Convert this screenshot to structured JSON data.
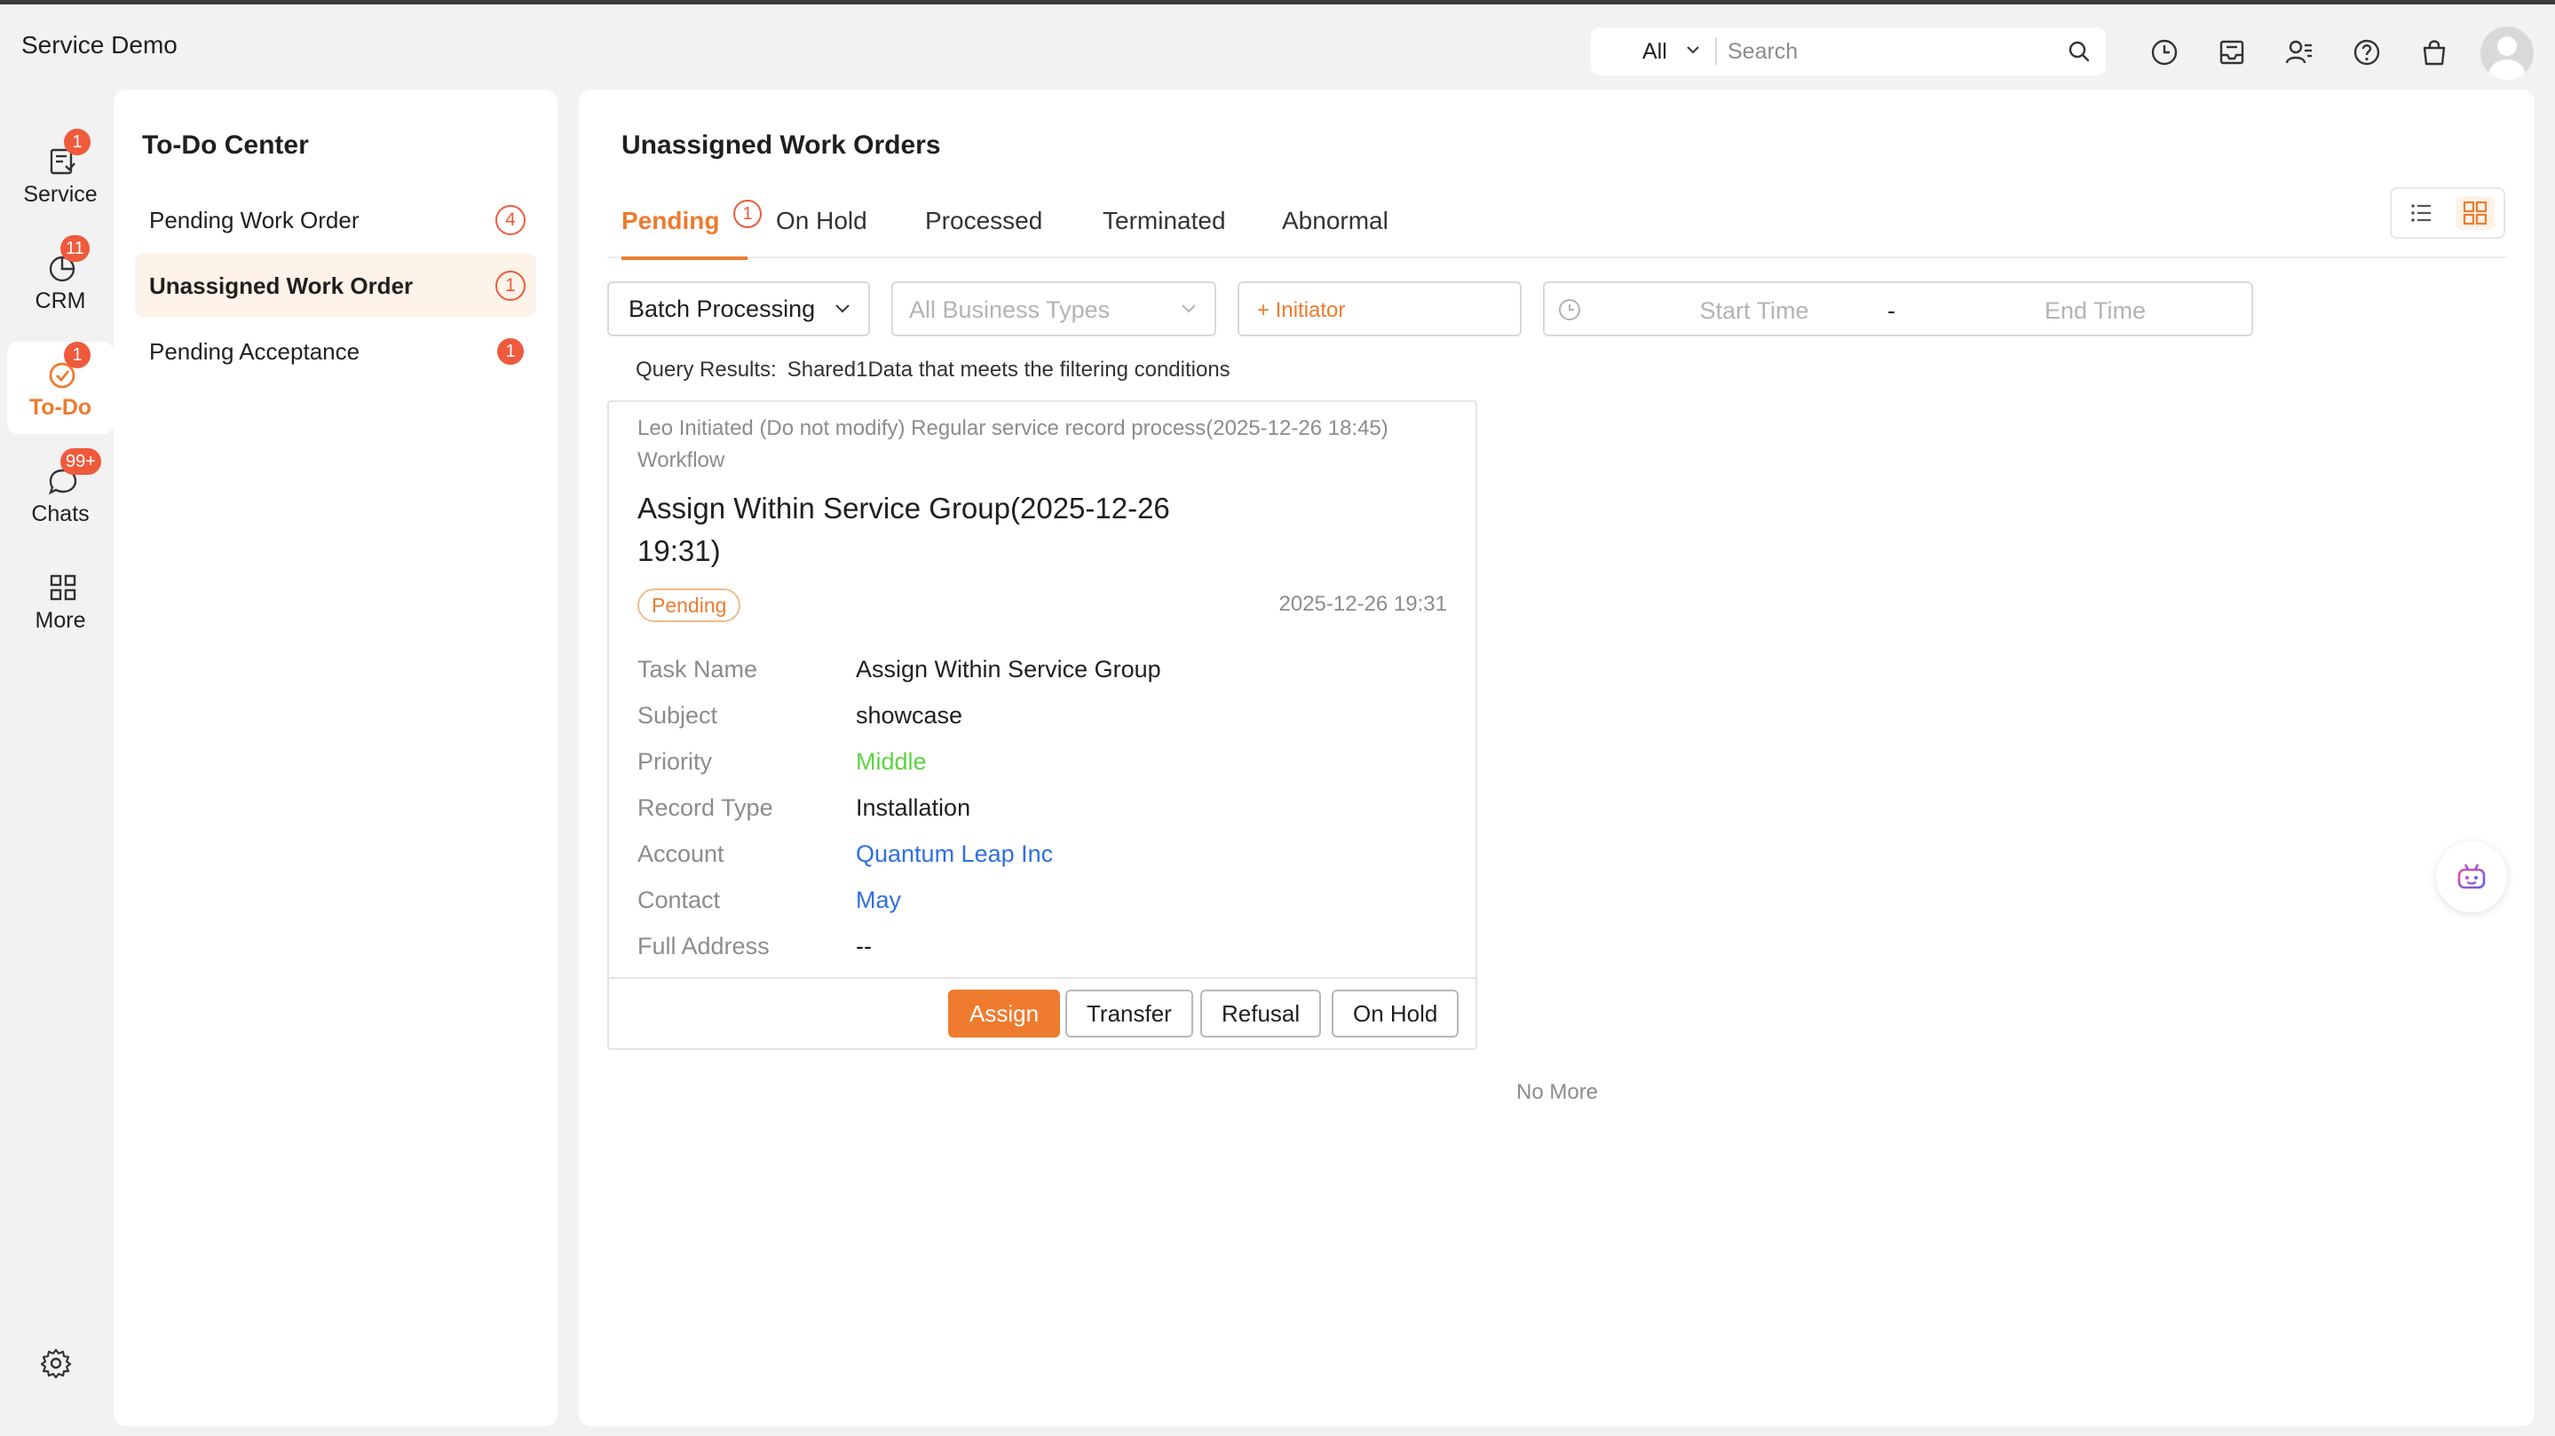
{
  "app": {
    "title": "Service Demo"
  },
  "search": {
    "scope": "All",
    "placeholder": "Search"
  },
  "header_icons": [
    "clock-icon",
    "inbox-icon",
    "user-manage-icon",
    "help-icon",
    "shopping-bag-icon"
  ],
  "rail": {
    "items": [
      {
        "label": "Service",
        "badge": "1",
        "icon": "service-icon"
      },
      {
        "label": "CRM",
        "badge": "11",
        "icon": "crm-icon"
      },
      {
        "label": "To-Do",
        "badge": "1",
        "icon": "todo-check-icon",
        "active": true
      },
      {
        "label": "Chats",
        "badge": "99+",
        "icon": "chat-icon"
      },
      {
        "label": "More",
        "badge": "",
        "icon": "grid-icon"
      }
    ]
  },
  "todo_panel": {
    "title": "To-Do Center",
    "items": [
      {
        "label": "Pending Work Order",
        "count": "4"
      },
      {
        "label": "Unassigned Work Order",
        "count": "1",
        "active": true
      },
      {
        "label": "Pending Acceptance",
        "count": "1"
      }
    ]
  },
  "main": {
    "title": "Unassigned Work Orders",
    "tabs": [
      {
        "label": "Pending",
        "badge": "1",
        "active": true
      },
      {
        "label": "On Hold"
      },
      {
        "label": "Processed"
      },
      {
        "label": "Terminated"
      },
      {
        "label": "Abnormal"
      }
    ],
    "filters": {
      "batch": "Batch Processing",
      "business_types_placeholder": "All Business Types",
      "initiator": "+ Initiator",
      "start_time_placeholder": "Start Time",
      "range_separator": "-",
      "end_time_placeholder": "End Time"
    },
    "query": {
      "label": "Query Results:",
      "text": "Shared1Data that meets the filtering conditions"
    },
    "card": {
      "origin": "Leo Initiated (Do not modify) Regular service record process(2025-12-26 18:45)",
      "origin_type": "Workflow",
      "title": "Assign Within Service Group(2025-12-26 19:31)",
      "status": "Pending",
      "time": "2025-12-26 19:31",
      "fields": [
        {
          "label": "Task Name",
          "value": "Assign Within Service Group"
        },
        {
          "label": "Subject",
          "value": "showcase"
        },
        {
          "label": "Priority",
          "value": "Middle"
        },
        {
          "label": "Record Type",
          "value": "Installation"
        },
        {
          "label": "Account",
          "value": "Quantum Leap Inc"
        },
        {
          "label": "Contact",
          "value": "May"
        },
        {
          "label": "Full Address",
          "value": "--"
        }
      ],
      "buttons": {
        "assign": "Assign",
        "transfer": "Transfer",
        "refusal": "Refusal",
        "on_hold": "On Hold"
      }
    },
    "no_more": "No More"
  },
  "colors": {
    "accent": "#ee7b2e",
    "badge": "#ef5a3c",
    "link": "#2f6fe4",
    "priority_middle": "#5dd43e"
  }
}
